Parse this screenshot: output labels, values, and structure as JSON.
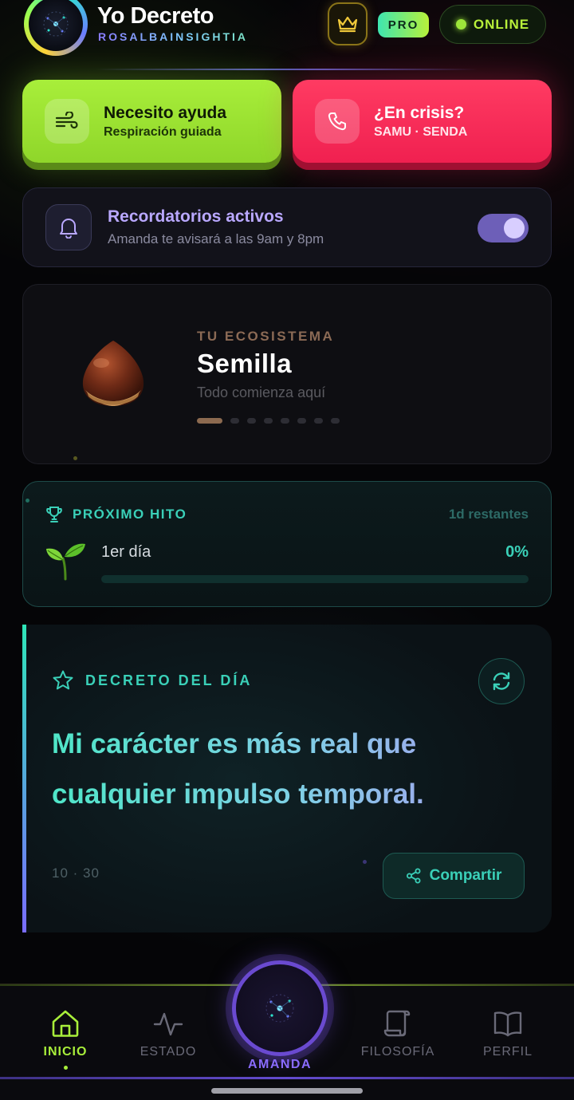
{
  "header": {
    "title": "Yo Decreto",
    "subtitle": "ROSALBAINSIGHTIA",
    "pro_label": "PRO",
    "online_label": "ONLINE",
    "colors": {
      "accent_green": "#a8ee3a",
      "accent_teal": "#3ad0b8",
      "accent_purple": "#7a6cff",
      "accent_red": "#f02050"
    }
  },
  "actions": {
    "help": {
      "title": "Necesito ayuda",
      "subtitle": "Respiración guiada",
      "icon": "wind-icon"
    },
    "crisis": {
      "title": "¿En crisis?",
      "subtitle": "SAMU · SENDA",
      "icon": "phone-icon"
    }
  },
  "reminders": {
    "title": "Recordatorios activos",
    "subtitle": "Amanda te avisará a las 9am y 8pm",
    "enabled": true
  },
  "ecosystem": {
    "label": "TU ECOSISTEMA",
    "title": "Semilla",
    "subtitle": "Todo comienza aquí",
    "stage_index": 0,
    "stage_count": 8
  },
  "milestone": {
    "label": "PRÓXIMO HITO",
    "remaining": "1d restantes",
    "name": "1er día",
    "percent_label": "0%",
    "progress": 0
  },
  "decree": {
    "label": "DECRETO DEL DÍA",
    "text": "Mi carácter es más real que cualquier impulso temporal.",
    "date": "10 · 30",
    "share_label": "Compartir"
  },
  "nav": {
    "items": [
      {
        "label": "INICIO",
        "icon": "home-icon",
        "active": true
      },
      {
        "label": "ESTADO",
        "icon": "pulse-icon",
        "active": false
      },
      {
        "label": "AMANDA",
        "icon": "amanda-orb-icon",
        "active": false
      },
      {
        "label": "FILOSOFÍA",
        "icon": "scroll-icon",
        "active": false
      },
      {
        "label": "PERFIL",
        "icon": "book-icon",
        "active": false
      }
    ]
  }
}
